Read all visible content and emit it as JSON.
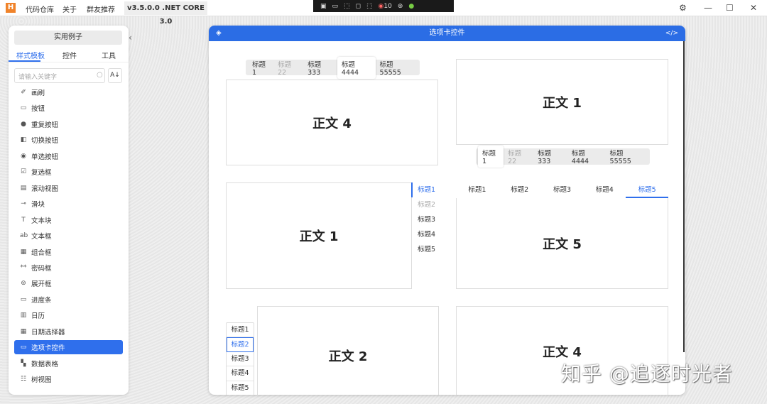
{
  "topbar": {
    "logo": "H",
    "menu": [
      "代码仓库",
      "关于",
      "群友推荐"
    ],
    "version": "v3.5.0.0 .NET CORE 3.0",
    "float_count": "10"
  },
  "sidebar": {
    "example_button": "实用例子",
    "tabs": [
      "样式模板",
      "控件",
      "工具"
    ],
    "search_placeholder": "请输入关键字",
    "sort": "A↓",
    "items": [
      {
        "label": "画刷",
        "icon": "✐"
      },
      {
        "label": "按钮",
        "icon": "▭"
      },
      {
        "label": "重复按钮",
        "icon": "●"
      },
      {
        "label": "切换按钮",
        "icon": "◧"
      },
      {
        "label": "单选按钮",
        "icon": "◉"
      },
      {
        "label": "复选框",
        "icon": "☑"
      },
      {
        "label": "滚动视图",
        "icon": "▤"
      },
      {
        "label": "滑块",
        "icon": "⊸"
      },
      {
        "label": "文本块",
        "icon": "T"
      },
      {
        "label": "文本框",
        "icon": "ab"
      },
      {
        "label": "组合框",
        "icon": "▦"
      },
      {
        "label": "密码框",
        "icon": "**"
      },
      {
        "label": "展开框",
        "icon": "⊚"
      },
      {
        "label": "进度条",
        "icon": "▭"
      },
      {
        "label": "日历",
        "icon": "▥"
      },
      {
        "label": "日期选择器",
        "icon": "▦"
      },
      {
        "label": "选项卡控件",
        "icon": "▭"
      },
      {
        "label": "数据表格",
        "icon": "▚"
      },
      {
        "label": "树视图",
        "icon": "☷"
      }
    ],
    "selected": "选项卡控件"
  },
  "window": {
    "title": "选项卡控件"
  },
  "demos": {
    "p1": {
      "tabs": [
        "标题1",
        "标题22",
        "标题333",
        "标题4444",
        "标题55555"
      ],
      "content": "正文 4"
    },
    "p2": {
      "tabs": [
        "标题1",
        "标题22",
        "标题333",
        "标题4444",
        "标题55555"
      ],
      "content": "正文 1"
    },
    "p3": {
      "tabs": [
        "标题1",
        "标题2",
        "标题3",
        "标题4",
        "标题5"
      ],
      "content": "正文 1"
    },
    "p4": {
      "tabs": [
        "标题1",
        "标题2",
        "标题3",
        "标题4",
        "标题5"
      ],
      "content": "正文 5"
    },
    "p5": {
      "tabs": [
        "标题1",
        "标题2",
        "标题3",
        "标题4",
        "标题5"
      ],
      "content": "正文 2"
    },
    "p6": {
      "content": "正文 4"
    }
  },
  "watermark": "知乎 @追逐时光者",
  "colors": {
    "accent": "#2f6fec",
    "header": "#2b6de5"
  }
}
